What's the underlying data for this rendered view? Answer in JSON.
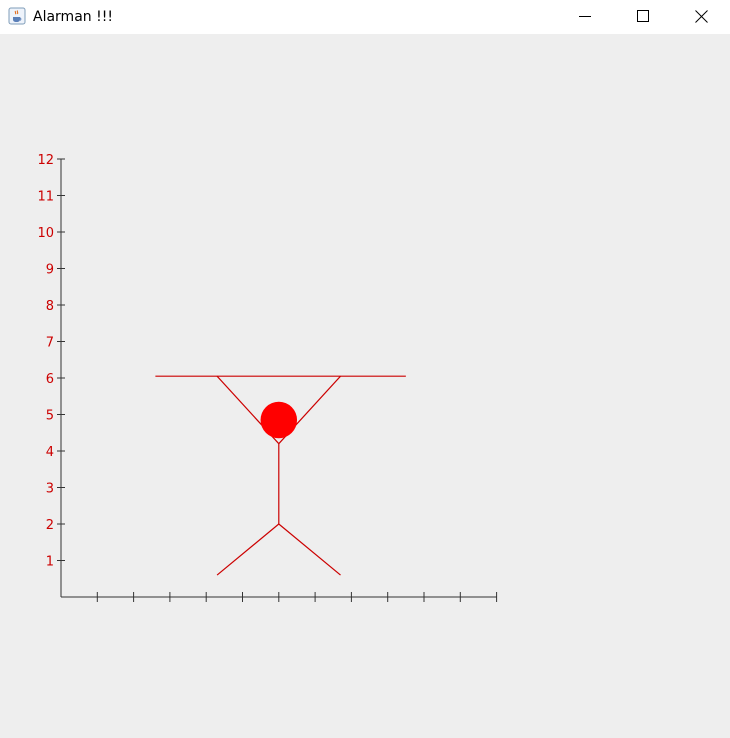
{
  "window": {
    "title": "Alarman !!!",
    "app_icon": "java-cup-icon",
    "controls": [
      "minimize-icon",
      "maximize-icon",
      "close-icon"
    ]
  },
  "colors": {
    "drawing": "#cc0000",
    "ball": "#ff0000",
    "axis": "#333333",
    "tick_label": "#cc0000",
    "background": "#eeeeee",
    "titlebar": "#ffffff"
  },
  "chart_data": {
    "type": "line",
    "ylim": [
      0,
      12
    ],
    "xlim": [
      0,
      12
    ],
    "y_tick_labels": [
      "1",
      "2",
      "3",
      "4",
      "5",
      "6",
      "7",
      "8",
      "9",
      "10",
      "11",
      "12"
    ],
    "x_tick_count": 12,
    "x_tick_labels_shown": false,
    "grid": false,
    "figure": {
      "bar": [
        [
          2.6,
          6.05
        ],
        [
          9.5,
          6.05
        ]
      ],
      "left_arm": [
        [
          4.3,
          6.05
        ],
        [
          6.0,
          4.2
        ]
      ],
      "right_arm": [
        [
          7.7,
          6.05
        ],
        [
          6.0,
          4.2
        ]
      ],
      "body": [
        [
          6.0,
          4.2
        ],
        [
          6.0,
          2.0
        ]
      ],
      "left_leg": [
        [
          6.0,
          2.0
        ],
        [
          4.3,
          0.6
        ]
      ],
      "right_leg": [
        [
          6.0,
          2.0
        ],
        [
          7.7,
          0.6
        ]
      ],
      "ball": {
        "center": [
          6.0,
          4.85
        ],
        "radius": 0.5
      }
    }
  }
}
